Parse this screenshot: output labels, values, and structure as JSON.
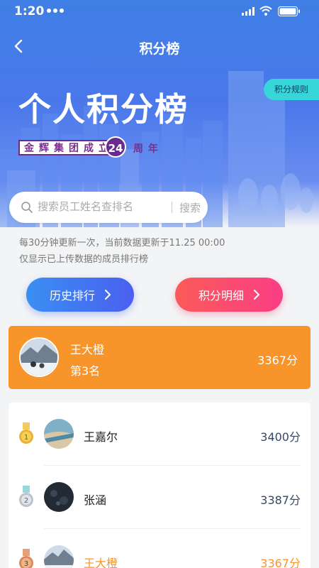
{
  "status": {
    "time": "1:20"
  },
  "header": {
    "title": "积分榜",
    "rules_label": "积分规则"
  },
  "hero": {
    "title": "个人积分榜",
    "anniversary_prefix": "金辉集团成立",
    "anniversary_number": "24",
    "anniversary_suffix": "周年"
  },
  "search": {
    "placeholder": "搜索员工姓名查排名",
    "button_label": "搜索"
  },
  "notice": {
    "line1": "每30分钟更新一次，当前数据更新于11.25   00:00",
    "line2": "仅显示已上传数据的成员排行榜"
  },
  "actions": {
    "history_label": "历史排行",
    "detail_label": "积分明细"
  },
  "my_rank": {
    "name": "王大橙",
    "rank_text": "第3名",
    "score": "3367分"
  },
  "ranking": [
    {
      "rank": "1",
      "name": "王嘉尔",
      "score": "3400分",
      "medal": "gold-medal"
    },
    {
      "rank": "2",
      "name": "张涵",
      "score": "3387分",
      "medal": "silver-medal"
    },
    {
      "rank": "3",
      "name": "王大橙",
      "score": "3367分",
      "medal": "bronze-medal"
    }
  ],
  "colors": {
    "hero_blue": "#4a78ea",
    "accent_orange": "#f7952a",
    "rules_cyan": "#36d6d9",
    "history_gradient": [
      "#3a8ff2",
      "#4a5ff0"
    ],
    "detail_gradient": [
      "#fb5b59",
      "#fa3e84"
    ],
    "gold": "#e8b23a",
    "silver": "#b9c3cc",
    "bronze": "#d98b5c"
  }
}
